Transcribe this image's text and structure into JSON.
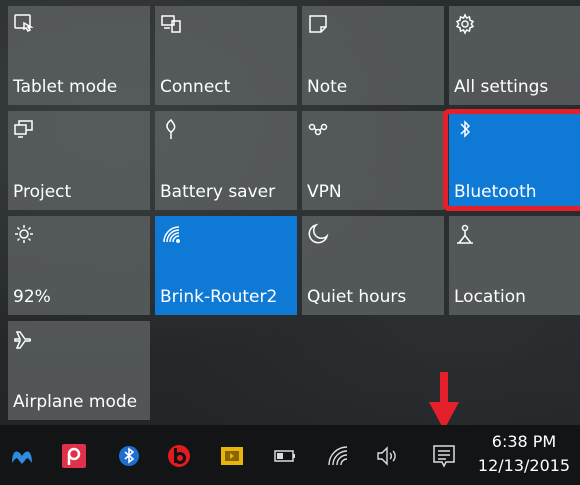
{
  "colors": {
    "tile_off": "#5c6062",
    "tile_on": "#0f79d6",
    "highlight": "#e6202a",
    "taskbar": "#121416"
  },
  "action_center": {
    "tiles": [
      {
        "label": "Tablet mode",
        "icon": "tablet-mode-icon",
        "active": false
      },
      {
        "label": "Connect",
        "icon": "connect-icon",
        "active": false
      },
      {
        "label": "Note",
        "icon": "note-icon",
        "active": false
      },
      {
        "label": "All settings",
        "icon": "gear-icon",
        "active": false
      },
      {
        "label": "Project",
        "icon": "project-icon",
        "active": false
      },
      {
        "label": "Battery saver",
        "icon": "battery-saver-icon",
        "active": false
      },
      {
        "label": "VPN",
        "icon": "vpn-icon",
        "active": false
      },
      {
        "label": "Bluetooth",
        "icon": "bluetooth-icon",
        "active": true
      },
      {
        "label": "92%",
        "icon": "brightness-icon",
        "active": false
      },
      {
        "label": "Brink-Router2",
        "icon": "wifi-icon",
        "active": true
      },
      {
        "label": "Quiet hours",
        "icon": "moon-icon",
        "active": false
      },
      {
        "label": "Location",
        "icon": "location-icon",
        "active": false
      },
      {
        "label": "Airplane mode",
        "icon": "airplane-icon",
        "active": false
      }
    ]
  },
  "taskbar": {
    "icons": [
      "malwarebytes-icon",
      "pocket-icon",
      "bluetooth-tray-icon",
      "beats-icon",
      "media-icon",
      "battery-icon",
      "wifi-tray-icon",
      "volume-icon",
      "action-center-icon"
    ],
    "time": "6:38 PM",
    "date": "12/13/2015"
  }
}
